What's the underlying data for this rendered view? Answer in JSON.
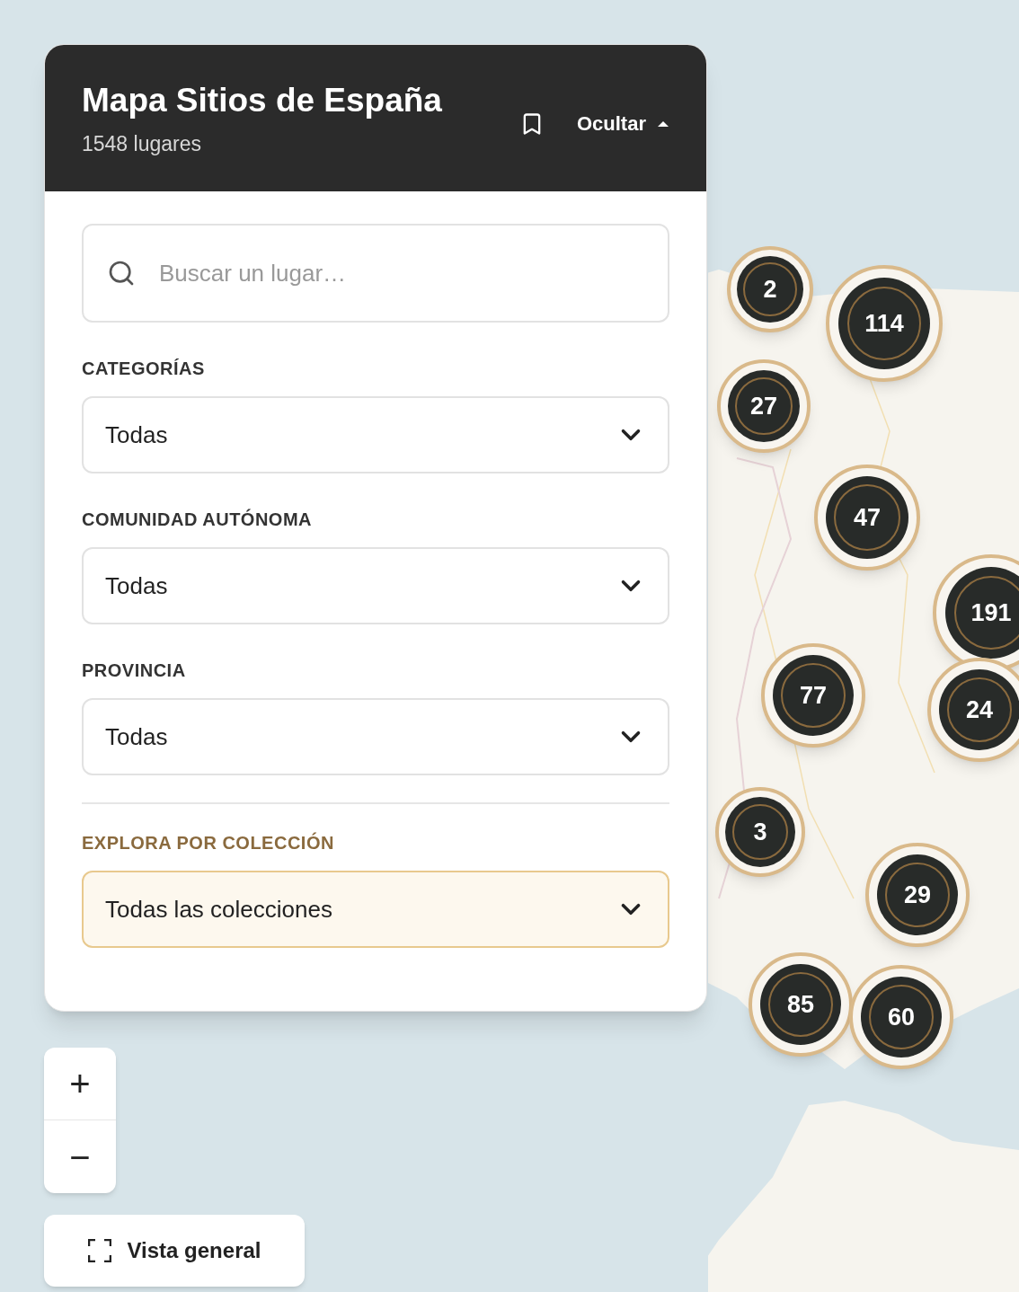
{
  "panel": {
    "title": "Mapa Sitios de España",
    "subtitle": "1548 lugares",
    "toggle": {
      "label": "Ocultar",
      "expanded": true
    },
    "search": {
      "placeholder": "Buscar un lugar…"
    },
    "filters": [
      {
        "label": "CATEGORÍAS",
        "value": "Todas",
        "kind": "plain"
      },
      {
        "label": "COMUNIDAD AUTÓNOMA",
        "value": "Todas",
        "kind": "plain"
      },
      {
        "label": "PROVINCIA",
        "value": "Todas",
        "kind": "plain"
      },
      {
        "label": "EXPLORA POR COLECCIÓN",
        "value": "Todas las colecciones",
        "kind": "highlight"
      }
    ]
  },
  "clusters": [
    {
      "count": "2"
    },
    {
      "count": "114"
    },
    {
      "count": "27"
    },
    {
      "count": "47"
    },
    {
      "count": "191"
    },
    {
      "count": "77"
    },
    {
      "count": "24"
    },
    {
      "count": "3"
    },
    {
      "count": "29"
    },
    {
      "count": "85"
    },
    {
      "count": "60"
    }
  ],
  "zoom": {
    "in": "+",
    "out": "−"
  },
  "overview_button": {
    "label": "Vista general"
  }
}
